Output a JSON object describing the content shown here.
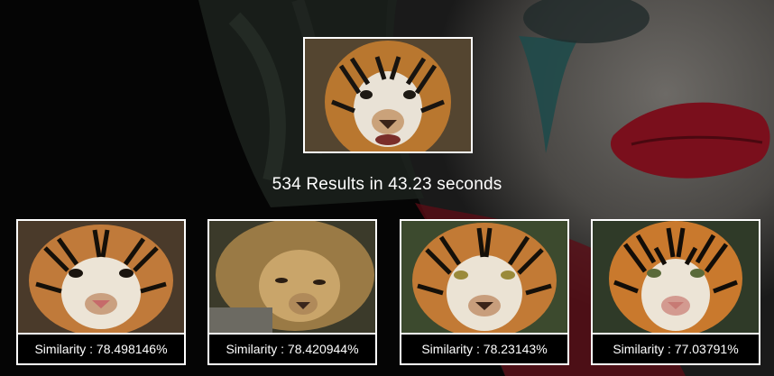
{
  "query_image": {
    "subject": "tiger-face-photo"
  },
  "results_summary": {
    "count": "534",
    "time": "43.23",
    "text": "534 Results in 43.23 seconds"
  },
  "results": [
    {
      "subject": "tiger-face-photo",
      "similarity_label": "Similarity : ",
      "similarity_value": "78.498146%"
    },
    {
      "subject": "lion-face-photo",
      "similarity_label": "Similarity : ",
      "similarity_value": "78.420944%"
    },
    {
      "subject": "tiger-face-photo",
      "similarity_label": "Similarity : ",
      "similarity_value": "78.23143%"
    },
    {
      "subject": "tiger-face-photo",
      "similarity_label": "Similarity : ",
      "similarity_value": "77.03791%"
    }
  ],
  "colors": {
    "background": "#050505",
    "accent_red": "#8a1020",
    "frame": "#ffffff",
    "text": "#ffffff"
  }
}
